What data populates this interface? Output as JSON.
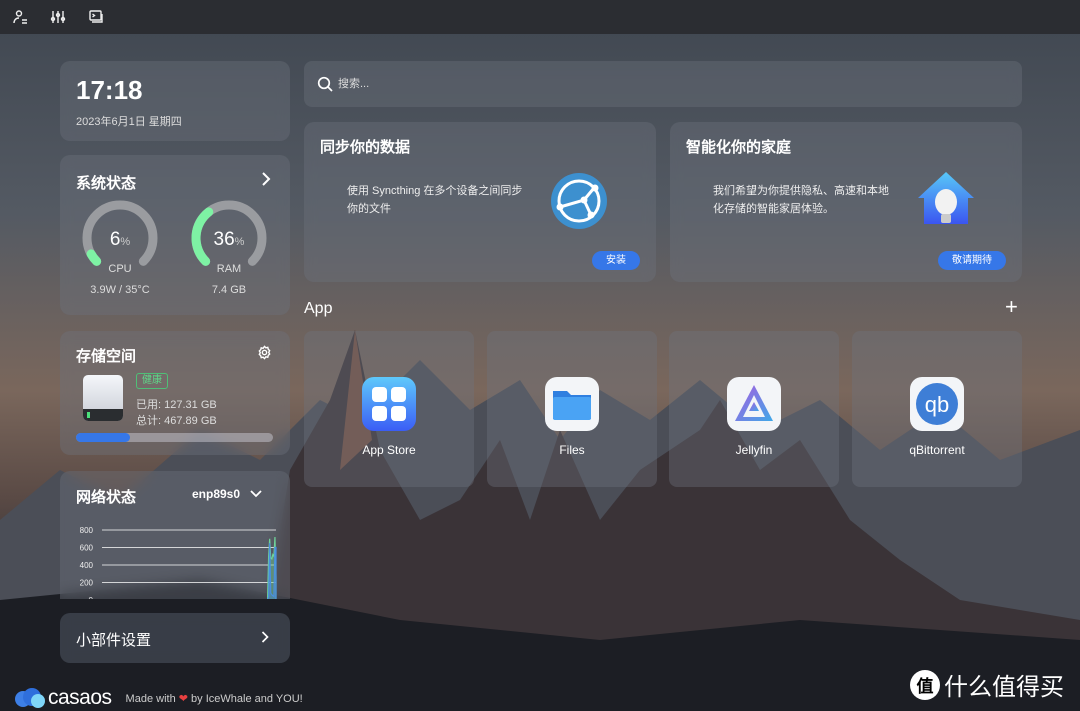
{
  "topbar": {
    "icons": [
      "user-settings-icon",
      "sliders-icon",
      "terminal-icon"
    ]
  },
  "clock": {
    "time": "17:18",
    "date": "2023年6月1日 星期四"
  },
  "system": {
    "title": "系统状态",
    "cpu": {
      "percent": 6,
      "unit": "%",
      "label": "CPU",
      "detail": "3.9W / 35°C"
    },
    "ram": {
      "percent": 36,
      "unit": "%",
      "label": "RAM",
      "detail": "7.4 GB"
    },
    "gauge_color": "#7ef2a4"
  },
  "storage": {
    "title": "存储空间",
    "badge": "健康",
    "used": "已用: 127.31 GB",
    "total": "总计: 467.89 GB",
    "used_fraction": 0.272,
    "bar_color": "#3677e8"
  },
  "network": {
    "title": "网络状态",
    "interface": "enp89s0",
    "chart_data": {
      "type": "area",
      "y_ticks": [
        "800",
        "600",
        "400",
        "200",
        "0"
      ],
      "ylim": [
        0,
        800
      ],
      "series": [
        {
          "color": "#6fd39a",
          "values": [
            0,
            0,
            0,
            0,
            0,
            0,
            0,
            0,
            0,
            0,
            0,
            0,
            0,
            0,
            0,
            0,
            0,
            0,
            0,
            0,
            0,
            0,
            0,
            0,
            0,
            0,
            0,
            0,
            0,
            0,
            0,
            0,
            0,
            0,
            0,
            0,
            0,
            0,
            0,
            0,
            0,
            0,
            0,
            0,
            0,
            0,
            0,
            0,
            0,
            0,
            0,
            0,
            0,
            0,
            0,
            0,
            0,
            0,
            0,
            0,
            0,
            0,
            0,
            0,
            0,
            0,
            0,
            0,
            0,
            0,
            0,
            0,
            0,
            0,
            0,
            0,
            0,
            0,
            0,
            0,
            0,
            0,
            0,
            0,
            0,
            0,
            0,
            0,
            0,
            0,
            0,
            0,
            0,
            0,
            0,
            0,
            0,
            0,
            0,
            0,
            0,
            0,
            0,
            0,
            0,
            0,
            0,
            0,
            0,
            0,
            0,
            0,
            0,
            0,
            0,
            0,
            0,
            0,
            0,
            0,
            0,
            0,
            0,
            0,
            0,
            0,
            0,
            0,
            0,
            0,
            0,
            0,
            0,
            0,
            0,
            0,
            0,
            0,
            0,
            0,
            0,
            0,
            0,
            0,
            0,
            0,
            0,
            0,
            0,
            0,
            0,
            0,
            0,
            0,
            0,
            0,
            0,
            0,
            500,
            700,
            480,
            470,
            520,
            500,
            720,
            260
          ]
        },
        {
          "color": "#4a8fe0",
          "values": [
            0,
            0,
            0,
            0,
            0,
            0,
            0,
            0,
            0,
            0,
            0,
            0,
            0,
            0,
            0,
            0,
            0,
            0,
            0,
            0,
            0,
            0,
            0,
            0,
            0,
            0,
            0,
            0,
            0,
            0,
            0,
            0,
            0,
            0,
            0,
            0,
            0,
            0,
            0,
            0,
            0,
            0,
            0,
            0,
            0,
            0,
            0,
            0,
            0,
            0,
            0,
            0,
            0,
            0,
            0,
            0,
            0,
            0,
            0,
            0,
            0,
            0,
            0,
            0,
            0,
            0,
            0,
            0,
            0,
            0,
            0,
            0,
            0,
            0,
            0,
            0,
            0,
            0,
            0,
            0,
            0,
            0,
            0,
            0,
            0,
            0,
            0,
            0,
            0,
            0,
            0,
            0,
            0,
            0,
            0,
            0,
            0,
            0,
            0,
            0,
            0,
            0,
            0,
            0,
            0,
            0,
            0,
            0,
            0,
            0,
            0,
            0,
            0,
            0,
            0,
            0,
            0,
            0,
            0,
            0,
            0,
            0,
            0,
            0,
            0,
            0,
            0,
            0,
            0,
            0,
            0,
            0,
            0,
            0,
            0,
            0,
            0,
            0,
            0,
            0,
            0,
            0,
            0,
            0,
            0,
            0,
            0,
            0,
            0,
            0,
            0,
            0,
            0,
            0,
            0,
            0,
            0,
            0,
            40,
            650,
            80,
            60,
            50,
            40,
            600,
            600
          ]
        }
      ]
    }
  },
  "widget_settings": {
    "label": "小部件设置"
  },
  "search": {
    "placeholder": "搜索..."
  },
  "promo": [
    {
      "title": "同步你的数据",
      "text": "使用 Syncthing 在多个设备之间同步你的文件",
      "button": "安装"
    },
    {
      "title": "智能化你的家庭",
      "text": "我们希望为你提供隐私、高速和本地化存储的智能家居体验。",
      "button": "敬请期待"
    }
  ],
  "apps": {
    "title": "App",
    "items": [
      {
        "name": "App Store"
      },
      {
        "name": "Files"
      },
      {
        "name": "Jellyfin"
      },
      {
        "name": "qBittorrent"
      }
    ]
  },
  "footer": {
    "logo": "casaos",
    "made_prefix": "Made with",
    "made_suffix": "by IceWhale and YOU!"
  },
  "watermark": "值 什么值得买"
}
